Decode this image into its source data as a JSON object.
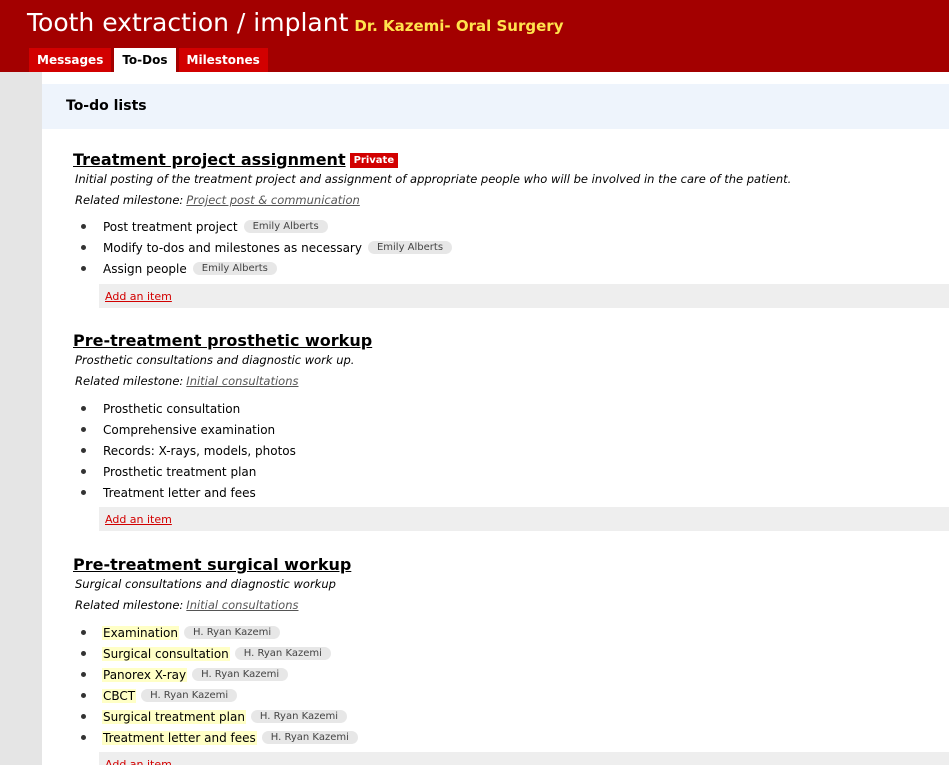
{
  "header": {
    "project_title": "Tooth extraction / implant",
    "company": "Dr. Kazemi- Oral Surgery",
    "tabs": [
      "Messages",
      "To-Dos",
      "Milestones"
    ],
    "active_tab": "To-Dos"
  },
  "main": {
    "section_title": "To-do lists",
    "add_item_label": "Add an item",
    "related_milestone_label": "Related milestone:",
    "lists": [
      {
        "title": "Treatment project assignment",
        "badge": "Private",
        "description": "Initial posting of the treatment project and assignment of appropriate people who will be involved in the care of the patient.",
        "milestone": "Project post & communication",
        "items": [
          {
            "text": "Post treatment project",
            "assignee": "Emily Alberts"
          },
          {
            "text": "Modify to-dos and milestones as necessary",
            "assignee": "Emily Alberts"
          },
          {
            "text": "Assign people",
            "assignee": "Emily Alberts"
          }
        ]
      },
      {
        "title": "Pre-treatment prosthetic workup",
        "description": "Prosthetic consultations and diagnostic work up.",
        "milestone": "Initial consultations",
        "items": [
          {
            "text": "Prosthetic consultation"
          },
          {
            "text": "Comprehensive examination"
          },
          {
            "text": "Records: X-rays, models, photos"
          },
          {
            "text": "Prosthetic treatment plan"
          },
          {
            "text": "Treatment letter and fees"
          }
        ]
      },
      {
        "title": "Pre-treatment surgical workup",
        "description": "Surgical consultations and diagnostic workup",
        "milestone": "Initial consultations",
        "items": [
          {
            "text": "Examination",
            "assignee": "H. Ryan Kazemi"
          },
          {
            "text": "Surgical consultation",
            "assignee": "H. Ryan Kazemi"
          },
          {
            "text": "Panorex X-ray",
            "assignee": "H. Ryan Kazemi"
          },
          {
            "text": "CBCT",
            "assignee": "H. Ryan Kazemi"
          },
          {
            "text": "Surgical treatment plan",
            "assignee": "H. Ryan Kazemi"
          },
          {
            "text": "Treatment letter and fees",
            "assignee": "H. Ryan Kazemi"
          }
        ]
      }
    ]
  },
  "colors": {
    "header_bg": "#a30000",
    "tab_bg": "#d20000",
    "company_text": "#ffe34d",
    "highlight": "#ffffc6"
  }
}
